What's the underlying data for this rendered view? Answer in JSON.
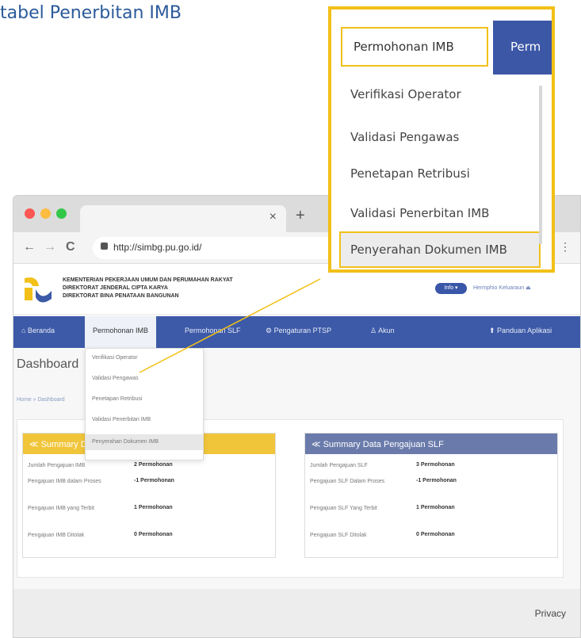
{
  "heading": "tabel Penerbitan IMB",
  "browser": {
    "tab_close": "×",
    "new_tab": "+",
    "back": "←",
    "forward": "→",
    "reload": "C",
    "url": "http://simbg.pu.go.id/",
    "menu": "⋮"
  },
  "site": {
    "ministry_line1": "KEMENTERIAN PEKERJAAN UMUM DAN PERUMAHAN RAKYAT",
    "ministry_line2": "DIREKTORAT JENDERAL CIPTA KARYA",
    "ministry_line3": "DIREKTORAT BINA PENATAAN BANGUNAN",
    "info_label": "Info ▾",
    "logout_label": "Hermphio Keluaraun ⏏"
  },
  "nav": {
    "beranda": "⌂ Beranda",
    "permohonan_imb": "Permohonan IMB",
    "permohonan_slf": "Permohonan SLF",
    "pengaturan_ptsp": "⚙ Pengaturan PTSP",
    "akun": "♙ Akun",
    "panduan": "⬆ Panduan Aplikasi"
  },
  "page": {
    "title": "Dashboard",
    "breadcrumb": "Home » Dashboard"
  },
  "dropdown_items": [
    "Verifikasi Operator",
    "Validasi Pengawas",
    "Penetapan Retribusi",
    "Validasi Penerbitan IMB",
    "Penyerahan Dokumen IMB"
  ],
  "panel_imb": {
    "title": "≪ Summary Data Pengajuan IMB",
    "rows": [
      {
        "label": "Jumlah Pengajuan IMB",
        "value": "2 Permohonan"
      },
      {
        "label": "Pengajuan IMB dalam Proses",
        "value": "-1 Permohonan"
      },
      {
        "label": "Pengajuan IMB yang Terbit",
        "value": "1 Permohonan"
      },
      {
        "label": "Pengajuan IMB Ditolak",
        "value": "0 Permohonan"
      }
    ]
  },
  "panel_slf": {
    "title": "≪ Summary Data Pengajuan SLF",
    "rows": [
      {
        "label": "Jumlah Pengajuan SLF",
        "value": "3 Permohonan"
      },
      {
        "label": "Pengajuan SLF Dalam Proses",
        "value": "-1 Permohonan"
      },
      {
        "label": "Pengajuan SLF Yang Terbit",
        "value": "1 Permohonan"
      },
      {
        "label": "Pengajuan SLF Ditolak",
        "value": "0 Permohonan"
      }
    ]
  },
  "footer": {
    "privacy": "Privacy"
  },
  "zoom": {
    "active_tab": "Permohonan IMB",
    "next_tab": "Perm",
    "items": [
      "Verifikasi Operator",
      "Validasi Pengawas",
      "Penetapan Retribusi",
      "Validasi Penerbitan IMB",
      "Penyerahan Dokumen IMB"
    ]
  },
  "colors": {
    "accent_yellow": "#f2c018",
    "nav_blue": "#3d5aa8",
    "heading_blue": "#2b5a9b"
  }
}
